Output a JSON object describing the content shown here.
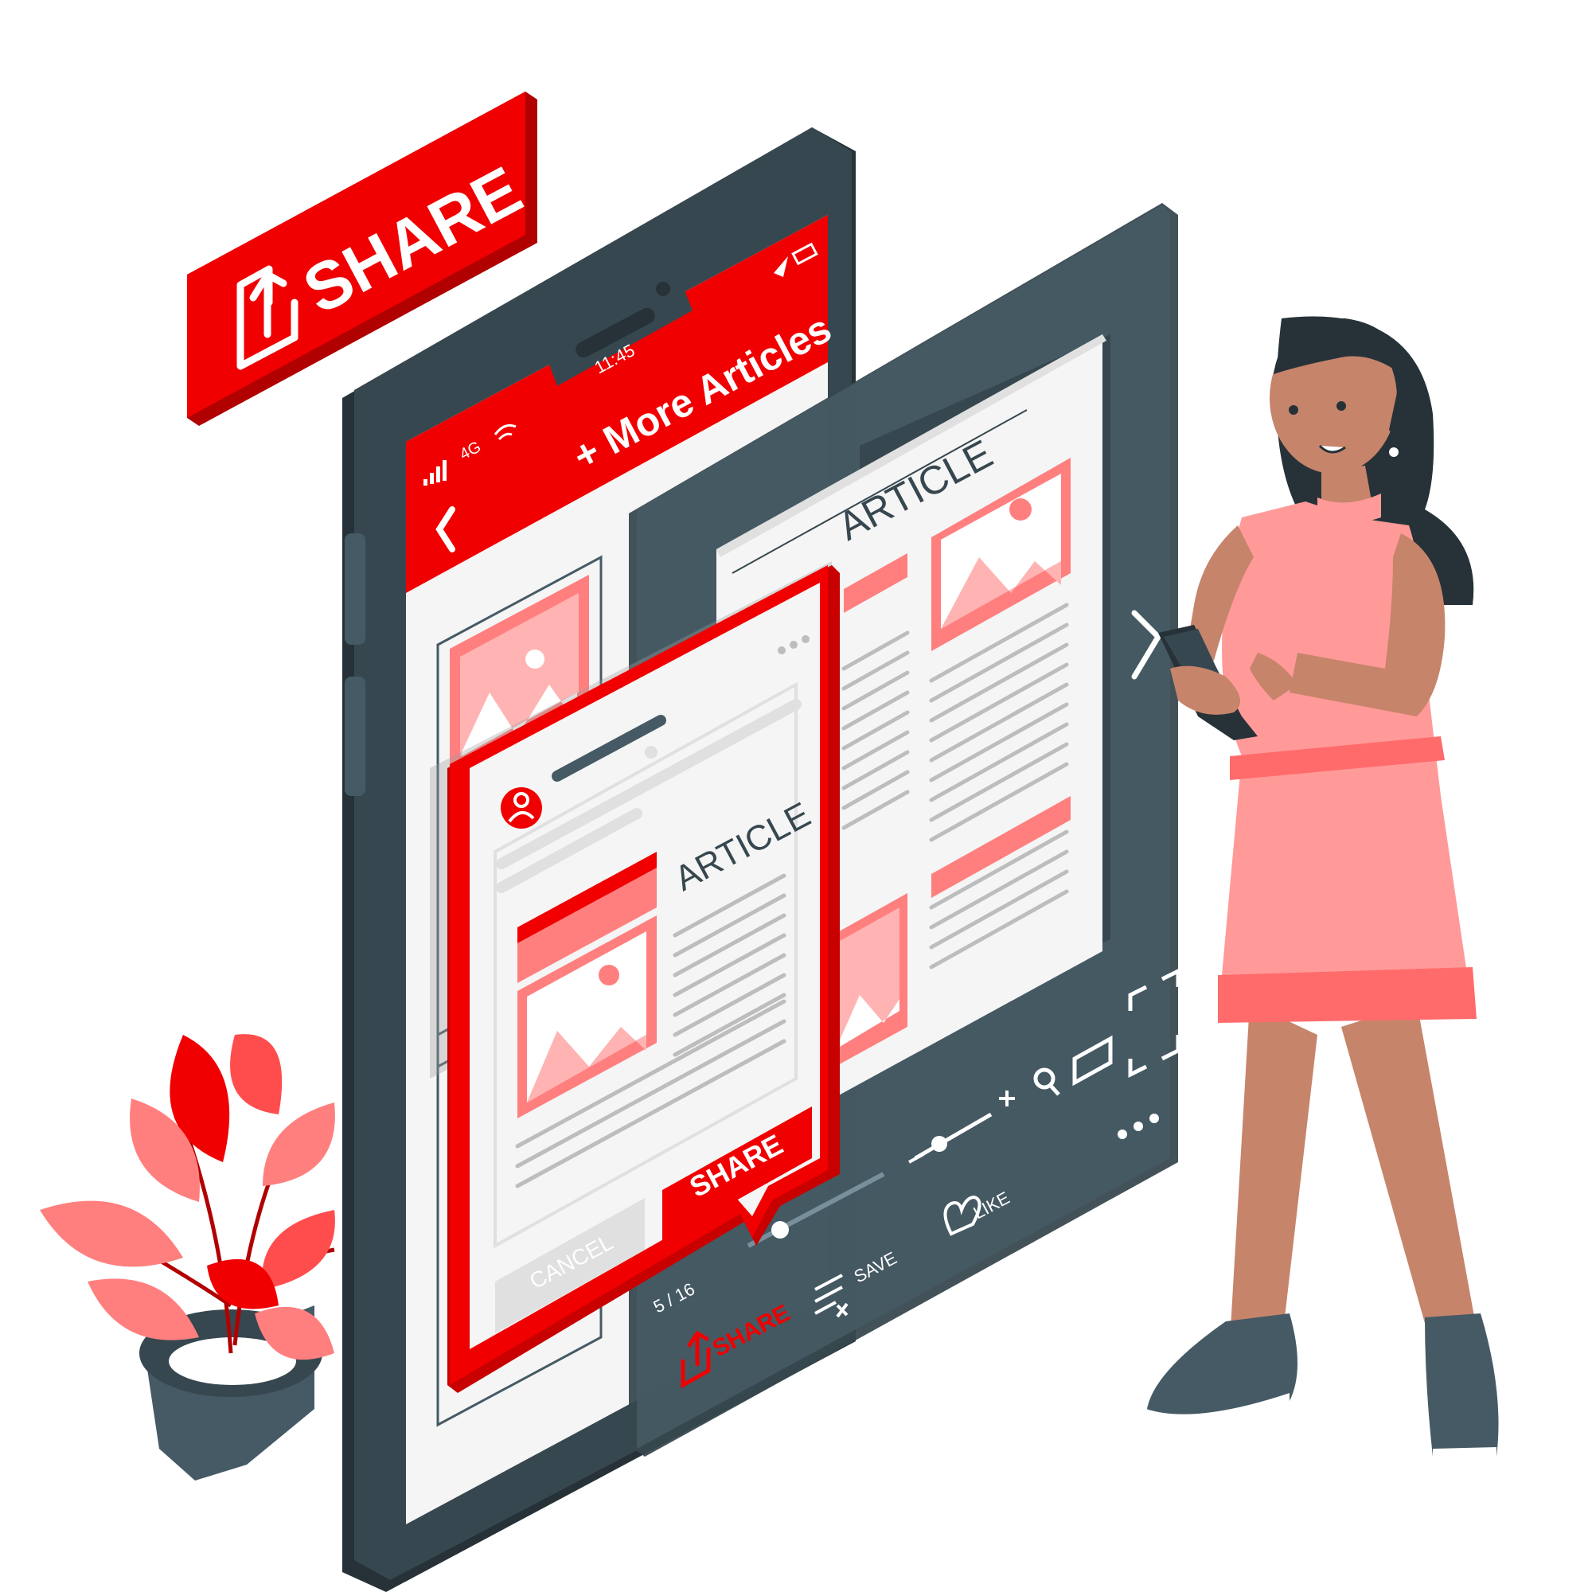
{
  "share_badge": {
    "label": "SHARE",
    "icon": "share-upload-icon"
  },
  "phone": {
    "status_bar": {
      "signal": "signal-bars-icon",
      "network": "4G",
      "wifi": "wifi-icon",
      "time": "11:45",
      "location": "location-arrow-icon",
      "battery": "battery-icon"
    },
    "header": {
      "back": "chevron-left-icon",
      "title": "+ More Articles"
    }
  },
  "reader": {
    "article_title": "ARTICLE",
    "page_indicator": "5 / 16",
    "actions": {
      "share_label": "SHARE",
      "save_label": "SAVE",
      "like_label": "LIKE"
    }
  },
  "share_dialog": {
    "article_title": "ARTICLE",
    "share_button": "SHARE",
    "cancel_button": "CANCEL"
  },
  "colors": {
    "accent_red": "#F00000",
    "light_red": "#FF7F7F",
    "pale_red": "#FFB3B3",
    "dark_gray": "#37474F",
    "mid_gray": "#455A64",
    "paper": "#F5F5F5"
  }
}
